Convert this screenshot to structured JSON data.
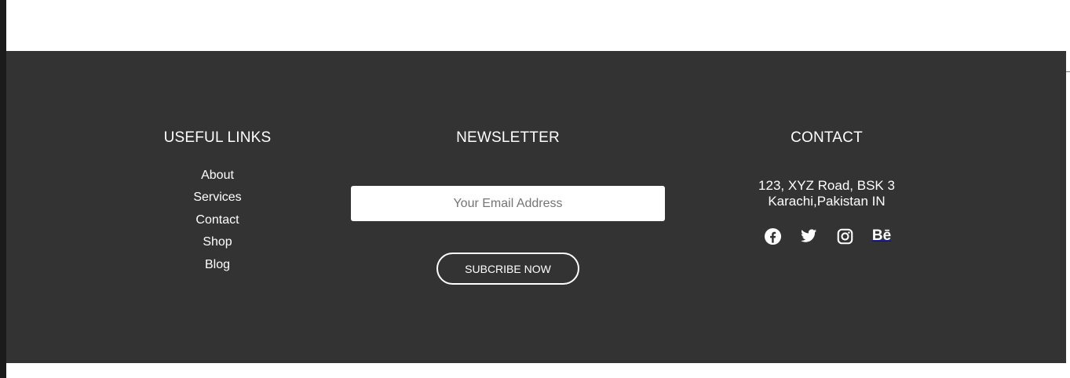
{
  "footer": {
    "useful_links": {
      "title": "USEFUL LINKS",
      "items": [
        {
          "label": "About"
        },
        {
          "label": "Services"
        },
        {
          "label": "Contact"
        },
        {
          "label": "Shop"
        },
        {
          "label": "Blog"
        }
      ]
    },
    "newsletter": {
      "title": "NEWSLETTER",
      "email_placeholder": "Your Email Address",
      "email_value": "",
      "subscribe_label": "SUBCRIBE NOW"
    },
    "contact": {
      "title": "CONTACT",
      "address_line1": "123, XYZ Road, BSK 3",
      "address_line2": "Karachi,Pakistan IN",
      "social": [
        "facebook-icon",
        "twitter-icon",
        "instagram-icon",
        "behance-icon"
      ],
      "behance_glyph": "Bē"
    }
  },
  "colors": {
    "footer_bg": "#333333",
    "text": "#ffffff",
    "page_bg": "#ffffff"
  }
}
